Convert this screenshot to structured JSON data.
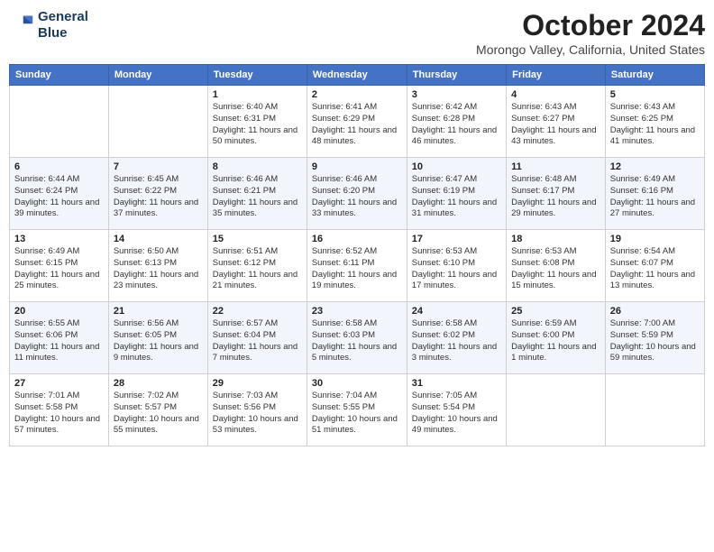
{
  "logo": {
    "line1": "General",
    "line2": "Blue"
  },
  "title": "October 2024",
  "subtitle": "Morongo Valley, California, United States",
  "header_color": "#4472c4",
  "days_of_week": [
    "Sunday",
    "Monday",
    "Tuesday",
    "Wednesday",
    "Thursday",
    "Friday",
    "Saturday"
  ],
  "weeks": [
    [
      {
        "day": "",
        "sunrise": "",
        "sunset": "",
        "daylight": ""
      },
      {
        "day": "",
        "sunrise": "",
        "sunset": "",
        "daylight": ""
      },
      {
        "day": "1",
        "sunrise": "Sunrise: 6:40 AM",
        "sunset": "Sunset: 6:31 PM",
        "daylight": "Daylight: 11 hours and 50 minutes."
      },
      {
        "day": "2",
        "sunrise": "Sunrise: 6:41 AM",
        "sunset": "Sunset: 6:29 PM",
        "daylight": "Daylight: 11 hours and 48 minutes."
      },
      {
        "day": "3",
        "sunrise": "Sunrise: 6:42 AM",
        "sunset": "Sunset: 6:28 PM",
        "daylight": "Daylight: 11 hours and 46 minutes."
      },
      {
        "day": "4",
        "sunrise": "Sunrise: 6:43 AM",
        "sunset": "Sunset: 6:27 PM",
        "daylight": "Daylight: 11 hours and 43 minutes."
      },
      {
        "day": "5",
        "sunrise": "Sunrise: 6:43 AM",
        "sunset": "Sunset: 6:25 PM",
        "daylight": "Daylight: 11 hours and 41 minutes."
      }
    ],
    [
      {
        "day": "6",
        "sunrise": "Sunrise: 6:44 AM",
        "sunset": "Sunset: 6:24 PM",
        "daylight": "Daylight: 11 hours and 39 minutes."
      },
      {
        "day": "7",
        "sunrise": "Sunrise: 6:45 AM",
        "sunset": "Sunset: 6:22 PM",
        "daylight": "Daylight: 11 hours and 37 minutes."
      },
      {
        "day": "8",
        "sunrise": "Sunrise: 6:46 AM",
        "sunset": "Sunset: 6:21 PM",
        "daylight": "Daylight: 11 hours and 35 minutes."
      },
      {
        "day": "9",
        "sunrise": "Sunrise: 6:46 AM",
        "sunset": "Sunset: 6:20 PM",
        "daylight": "Daylight: 11 hours and 33 minutes."
      },
      {
        "day": "10",
        "sunrise": "Sunrise: 6:47 AM",
        "sunset": "Sunset: 6:19 PM",
        "daylight": "Daylight: 11 hours and 31 minutes."
      },
      {
        "day": "11",
        "sunrise": "Sunrise: 6:48 AM",
        "sunset": "Sunset: 6:17 PM",
        "daylight": "Daylight: 11 hours and 29 minutes."
      },
      {
        "day": "12",
        "sunrise": "Sunrise: 6:49 AM",
        "sunset": "Sunset: 6:16 PM",
        "daylight": "Daylight: 11 hours and 27 minutes."
      }
    ],
    [
      {
        "day": "13",
        "sunrise": "Sunrise: 6:49 AM",
        "sunset": "Sunset: 6:15 PM",
        "daylight": "Daylight: 11 hours and 25 minutes."
      },
      {
        "day": "14",
        "sunrise": "Sunrise: 6:50 AM",
        "sunset": "Sunset: 6:13 PM",
        "daylight": "Daylight: 11 hours and 23 minutes."
      },
      {
        "day": "15",
        "sunrise": "Sunrise: 6:51 AM",
        "sunset": "Sunset: 6:12 PM",
        "daylight": "Daylight: 11 hours and 21 minutes."
      },
      {
        "day": "16",
        "sunrise": "Sunrise: 6:52 AM",
        "sunset": "Sunset: 6:11 PM",
        "daylight": "Daylight: 11 hours and 19 minutes."
      },
      {
        "day": "17",
        "sunrise": "Sunrise: 6:53 AM",
        "sunset": "Sunset: 6:10 PM",
        "daylight": "Daylight: 11 hours and 17 minutes."
      },
      {
        "day": "18",
        "sunrise": "Sunrise: 6:53 AM",
        "sunset": "Sunset: 6:08 PM",
        "daylight": "Daylight: 11 hours and 15 minutes."
      },
      {
        "day": "19",
        "sunrise": "Sunrise: 6:54 AM",
        "sunset": "Sunset: 6:07 PM",
        "daylight": "Daylight: 11 hours and 13 minutes."
      }
    ],
    [
      {
        "day": "20",
        "sunrise": "Sunrise: 6:55 AM",
        "sunset": "Sunset: 6:06 PM",
        "daylight": "Daylight: 11 hours and 11 minutes."
      },
      {
        "day": "21",
        "sunrise": "Sunrise: 6:56 AM",
        "sunset": "Sunset: 6:05 PM",
        "daylight": "Daylight: 11 hours and 9 minutes."
      },
      {
        "day": "22",
        "sunrise": "Sunrise: 6:57 AM",
        "sunset": "Sunset: 6:04 PM",
        "daylight": "Daylight: 11 hours and 7 minutes."
      },
      {
        "day": "23",
        "sunrise": "Sunrise: 6:58 AM",
        "sunset": "Sunset: 6:03 PM",
        "daylight": "Daylight: 11 hours and 5 minutes."
      },
      {
        "day": "24",
        "sunrise": "Sunrise: 6:58 AM",
        "sunset": "Sunset: 6:02 PM",
        "daylight": "Daylight: 11 hours and 3 minutes."
      },
      {
        "day": "25",
        "sunrise": "Sunrise: 6:59 AM",
        "sunset": "Sunset: 6:00 PM",
        "daylight": "Daylight: 11 hours and 1 minute."
      },
      {
        "day": "26",
        "sunrise": "Sunrise: 7:00 AM",
        "sunset": "Sunset: 5:59 PM",
        "daylight": "Daylight: 10 hours and 59 minutes."
      }
    ],
    [
      {
        "day": "27",
        "sunrise": "Sunrise: 7:01 AM",
        "sunset": "Sunset: 5:58 PM",
        "daylight": "Daylight: 10 hours and 57 minutes."
      },
      {
        "day": "28",
        "sunrise": "Sunrise: 7:02 AM",
        "sunset": "Sunset: 5:57 PM",
        "daylight": "Daylight: 10 hours and 55 minutes."
      },
      {
        "day": "29",
        "sunrise": "Sunrise: 7:03 AM",
        "sunset": "Sunset: 5:56 PM",
        "daylight": "Daylight: 10 hours and 53 minutes."
      },
      {
        "day": "30",
        "sunrise": "Sunrise: 7:04 AM",
        "sunset": "Sunset: 5:55 PM",
        "daylight": "Daylight: 10 hours and 51 minutes."
      },
      {
        "day": "31",
        "sunrise": "Sunrise: 7:05 AM",
        "sunset": "Sunset: 5:54 PM",
        "daylight": "Daylight: 10 hours and 49 minutes."
      },
      {
        "day": "",
        "sunrise": "",
        "sunset": "",
        "daylight": ""
      },
      {
        "day": "",
        "sunrise": "",
        "sunset": "",
        "daylight": ""
      }
    ]
  ]
}
